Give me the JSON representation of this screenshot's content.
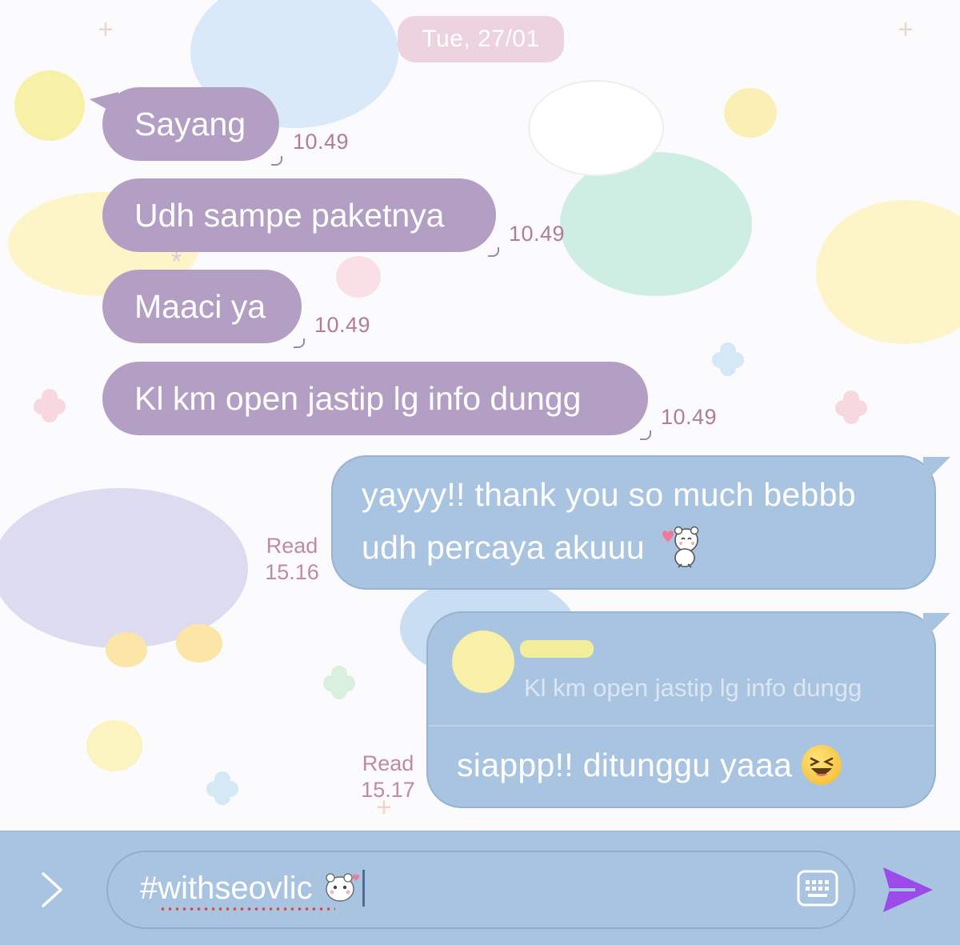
{
  "date_divider": "Tue, 27/01",
  "incoming": [
    {
      "text": "Sayang",
      "time": "10.49"
    },
    {
      "text": "Udh sampe paketnya",
      "time": "10.49"
    },
    {
      "text": "Maaci ya",
      "time": "10.49"
    },
    {
      "text": "Kl km open jastip lg info dungg",
      "time": "10.49"
    }
  ],
  "outgoing": [
    {
      "lines": [
        "yayyy!! thank you so much bebbb",
        "udh percaya akuuu"
      ],
      "sticker": "bear-heart-sticker",
      "read_label": "Read",
      "time": "15.16"
    },
    {
      "reply_to": {
        "text": "Kl km open jastip lg info dungg"
      },
      "text": "siappp!! ditunggu yaaa",
      "emoji": "laughing-emoji",
      "read_label": "Read",
      "time": "15.17"
    }
  ],
  "composer": {
    "value": "#withseovlic",
    "sticker": "bear-sticker",
    "expand_icon": "chevron-right-icon",
    "keyboard_icon": "keyboard-icon",
    "send_icon": "send-icon"
  },
  "colors": {
    "incoming_bubble": "#b39fc4",
    "outgoing_bubble": "#a9c4e0",
    "timestamp": "#b07d96",
    "send_accent": "#9b4bea"
  }
}
